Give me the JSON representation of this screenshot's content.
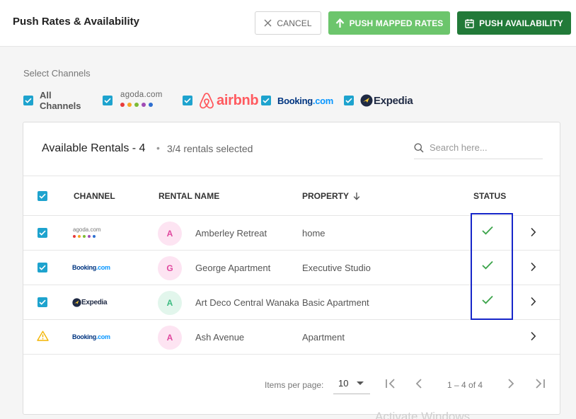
{
  "header": {
    "title": "Push Rates & Availability",
    "cancel_label": "CANCEL",
    "push_mapped_rates_label": "PUSH MAPPED RATES",
    "push_availability_label": "PUSH AVAILABILITY",
    "colors": {
      "mapped": "#6cc56c",
      "availability": "#227a39"
    }
  },
  "channels": {
    "label": "Select Channels",
    "all_label": "All Channels",
    "items": [
      {
        "name": "agoda.com",
        "checked": true
      },
      {
        "name": "airbnb",
        "checked": true
      },
      {
        "name": "Booking.com",
        "checked": true
      },
      {
        "name": "Expedia",
        "checked": true
      }
    ]
  },
  "rentals": {
    "title": "Available Rentals - 4",
    "separator": "•",
    "selected_text": "3/4 rentals selected",
    "search_placeholder": "Search here...",
    "columns": {
      "channel": "CHANNEL",
      "rental_name": "RENTAL NAME",
      "property": "PROPERTY",
      "status": "STATUS"
    },
    "rows": [
      {
        "channel": "agoda.com",
        "initial": "A",
        "name": "Amberley Retreat",
        "property": "home",
        "checked": true,
        "status": "check",
        "avatar_bg": "#fde4f2",
        "avatar_fg": "#e0479e"
      },
      {
        "channel": "Booking.com",
        "initial": "G",
        "name": "George Apartment",
        "property": "Executive Studio",
        "checked": true,
        "status": "check",
        "avatar_bg": "#fde4f2",
        "avatar_fg": "#e0479e"
      },
      {
        "channel": "Expedia",
        "initial": "A",
        "name": "Art Deco Central Wanaka",
        "property": "Basic Apartment",
        "checked": true,
        "status": "check",
        "avatar_bg": "#e2f6ec",
        "avatar_fg": "#3dbb82"
      },
      {
        "channel": "Booking.com",
        "initial": "A",
        "name": "Ash Avenue",
        "property": "Apartment",
        "checked": false,
        "status": "warning",
        "avatar_bg": "#fde4f2",
        "avatar_fg": "#e0479e"
      }
    ]
  },
  "pagination": {
    "items_per_page_label": "Items per page:",
    "items_per_page_value": "10",
    "range": "1 – 4 of 4"
  },
  "watermark": "Activate Windows"
}
